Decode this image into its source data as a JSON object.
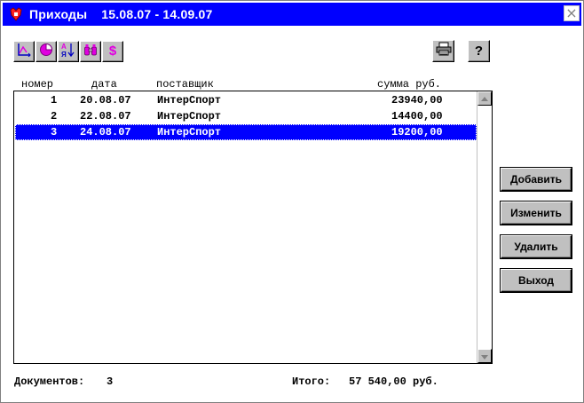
{
  "window": {
    "title": "Приходы",
    "period": "15.08.07 - 14.09.07",
    "close_glyph": "×"
  },
  "toolbar": {
    "tools": [
      {
        "icon": "axis-chart-icon"
      },
      {
        "icon": "pie-chart-icon"
      },
      {
        "icon": "sort-az-icon"
      },
      {
        "icon": "binoculars-icon"
      },
      {
        "icon": "dollar-icon",
        "label": "$"
      }
    ],
    "print_icon": "printer-icon",
    "help_label": "?"
  },
  "table": {
    "columns": [
      "номер",
      "дата",
      "поставщик",
      "сумма руб."
    ],
    "rows": [
      {
        "num": "1",
        "date": "20.08.07",
        "supplier": "ИнтерСпорт",
        "sum": "23940,00"
      },
      {
        "num": "2",
        "date": "22.08.07",
        "supplier": "ИнтерСпорт",
        "sum": "14400,00"
      },
      {
        "num": "3",
        "date": "24.08.07",
        "supplier": "ИнтерСпорт",
        "sum": "19200,00"
      }
    ],
    "selected_row": 3
  },
  "actions": {
    "add": "Добавить",
    "edit": "Изменить",
    "delete": "Удалить",
    "exit": "Выход"
  },
  "footer": {
    "docs_label": "Документов:",
    "docs_count": "3",
    "total_label": "Итого:",
    "total_value": "57 540,00 руб."
  },
  "colors": {
    "titlebar": "#0000ff",
    "selection": "#0000ff",
    "button_face": "#c0c0c0",
    "tool_magenta": "#e000e0"
  }
}
